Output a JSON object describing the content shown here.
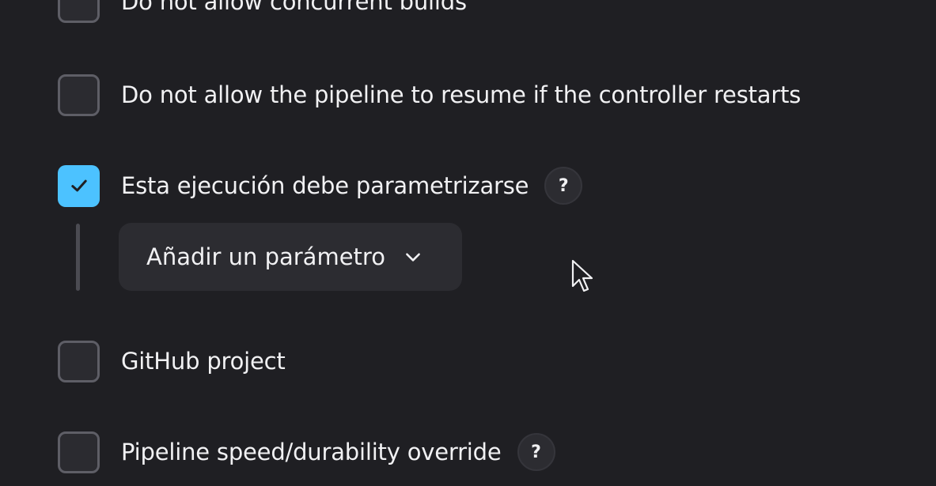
{
  "options": [
    {
      "label": "Do not allow concurrent builds",
      "checked": false
    },
    {
      "label": "Do not allow the pipeline to resume if the controller restarts",
      "checked": false
    },
    {
      "label": "Esta ejecución debe parametrizarse",
      "checked": true,
      "help": "?"
    },
    {
      "label": "GitHub project",
      "checked": false
    },
    {
      "label": "Pipeline speed/durability override",
      "checked": false,
      "help": "?"
    }
  ],
  "add_parameter": {
    "label": "Añadir un parámetro"
  },
  "colors": {
    "background": "#1f1f23",
    "accent": "#4cc2ff",
    "text": "#f1f1f3"
  }
}
